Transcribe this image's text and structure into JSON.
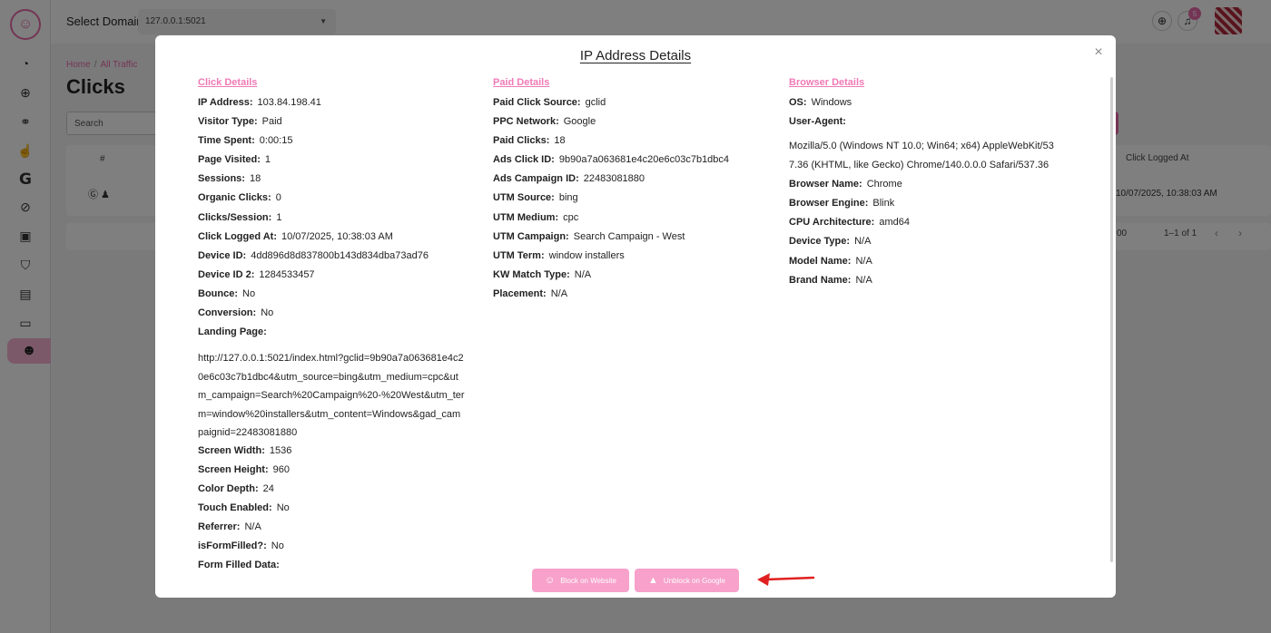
{
  "topbar": {
    "domain_label": "Select Domain",
    "domain_value": "127.0.0.1:5021",
    "notification_count": "5"
  },
  "page": {
    "breadcrumb_home": "Home",
    "breadcrumb_sep": "/",
    "breadcrumb_current": "All Traffic",
    "title": "Clicks",
    "search_placeholder": "Search",
    "table_header_hash": "#",
    "table_header_logged": "Click Logged At",
    "row_logged": "10/07/2025, 10:38:03 AM",
    "pager_rows": "00",
    "pager_range": "1–1 of 1"
  },
  "modal": {
    "title": "IP Address Details",
    "close": "×",
    "click_details": {
      "heading": "Click Details",
      "rows": [
        {
          "label": "IP Address:",
          "value": "103.84.198.41"
        },
        {
          "label": "Visitor Type:",
          "value": "Paid"
        },
        {
          "label": "Time Spent:",
          "value": "0:00:15"
        },
        {
          "label": "Page Visited:",
          "value": "1"
        },
        {
          "label": "Sessions:",
          "value": "18"
        },
        {
          "label": "Organic Clicks:",
          "value": "0"
        },
        {
          "label": "Clicks/Session:",
          "value": "1"
        },
        {
          "label": "Click Logged At:",
          "value": "10/07/2025, 10:38:03 AM"
        },
        {
          "label": "Device ID:",
          "value": "4dd896d8d837800b143d834dba73ad76"
        },
        {
          "label": "Device ID 2:",
          "value": "1284533457"
        },
        {
          "label": "Bounce:",
          "value": "No"
        },
        {
          "label": "Conversion:",
          "value": "No"
        },
        {
          "label": "Landing Page:",
          "value": ""
        }
      ],
      "landing_page_url": "http://127.0.0.1:5021/index.html?gclid=9b90a7a063681e4c20e6c03c7b1dbc4&utm_source=bing&utm_medium=cpc&utm_campaign=Search%20Campaign%20-%20West&utm_term=window%20installers&utm_content=Windows&gad_campaignid=22483081880",
      "rows_after": [
        {
          "label": "Screen Width:",
          "value": "1536"
        },
        {
          "label": "Screen Height:",
          "value": "960"
        },
        {
          "label": "Color Depth:",
          "value": "24"
        },
        {
          "label": "Touch Enabled:",
          "value": "No"
        },
        {
          "label": "Referrer:",
          "value": "N/A"
        },
        {
          "label": "isFormFilled?:",
          "value": "No"
        },
        {
          "label": "Form Filled Data:",
          "value": ""
        }
      ]
    },
    "paid_details": {
      "heading": "Paid Details",
      "rows": [
        {
          "label": "Paid Click Source:",
          "value": "gclid"
        },
        {
          "label": "PPC Network:",
          "value": "Google"
        },
        {
          "label": "Paid Clicks:",
          "value": "18"
        },
        {
          "label": "Ads Click ID:",
          "value": "9b90a7a063681e4c20e6c03c7b1dbc4"
        },
        {
          "label": "Ads Campaign ID:",
          "value": "22483081880"
        },
        {
          "label": "UTM Source:",
          "value": "bing"
        },
        {
          "label": "UTM Medium:",
          "value": "cpc"
        },
        {
          "label": "UTM Campaign:",
          "value": "Search Campaign - West"
        },
        {
          "label": "UTM Term:",
          "value": "window installers"
        },
        {
          "label": "KW Match Type:",
          "value": "N/A"
        },
        {
          "label": "Placement:",
          "value": "N/A"
        }
      ]
    },
    "browser_details": {
      "heading": "Browser Details",
      "rows_before": [
        {
          "label": "OS:",
          "value": "Windows"
        },
        {
          "label": "User-Agent:",
          "value": ""
        }
      ],
      "user_agent": "Mozilla/5.0 (Windows NT 10.0; Win64; x64) AppleWebKit/537.36 (KHTML, like Gecko) Chrome/140.0.0.0 Safari/537.36",
      "rows_after": [
        {
          "label": "Browser Name:",
          "value": "Chrome"
        },
        {
          "label": "Browser Engine:",
          "value": "Blink"
        },
        {
          "label": "CPU Architecture:",
          "value": "amd64"
        },
        {
          "label": "Device Type:",
          "value": "N/A"
        },
        {
          "label": "Model Name:",
          "value": "N/A"
        },
        {
          "label": "Brand Name:",
          "value": "N/A"
        }
      ]
    },
    "buttons": {
      "block_website": "Block on Website",
      "unblock_google": "Unblock on Google"
    }
  },
  "colors": {
    "accent_pink": "#f07ab6",
    "button_pink": "#f7a1cb",
    "annotation_arrow": "#e02020"
  },
  "icons": [
    "logo-icon",
    "chart-icon",
    "globe-icon",
    "link-icon",
    "tap-icon",
    "google-icon",
    "block-icon",
    "layers-icon",
    "shield-icon",
    "document-icon",
    "folder-icon",
    "monkey-icon",
    "bell-icon",
    "close-icon",
    "arrow-annotation-icon"
  ]
}
